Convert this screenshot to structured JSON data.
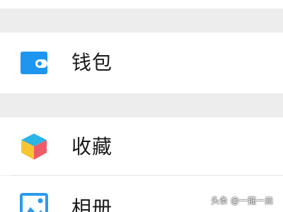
{
  "colors": {
    "background": "#ededed",
    "row_background": "#ffffff",
    "wallet_blue": "#1e96f0",
    "album_blue": "#2b9bf0"
  },
  "menu": {
    "items": [
      {
        "label": "钱包",
        "icon": "wallet-icon"
      },
      {
        "label": "收藏",
        "icon": "favorites-cube-icon"
      },
      {
        "label": "相册",
        "icon": "photo-album-icon"
      }
    ]
  },
  "watermark": {
    "text": "头条 @一箍一皿"
  }
}
